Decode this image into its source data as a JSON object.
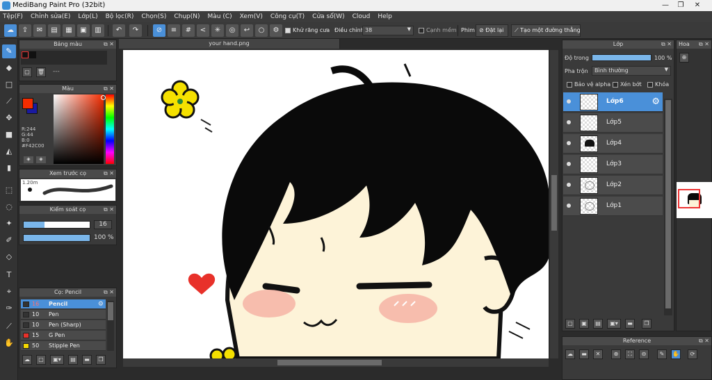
{
  "window": {
    "title": "MediBang Paint Pro (32bit)"
  },
  "menu": [
    "Tệp(F)",
    "Chỉnh sửa(E)",
    "Lớp(L)",
    "Bộ lọc(R)",
    "Chọn(S)",
    "Chụp(N)",
    "Màu (C)",
    "Xem(V)",
    "Công cụ(T)",
    "Cửa sổ(W)",
    "Cloud",
    "Help"
  ],
  "toolbar": {
    "antialias_label": "Khử răng cưa",
    "adjust_label": "Điều chỉnh",
    "adjust_value": "38",
    "snap_label": "Cạnh mềm",
    "pen_label": "Phim",
    "reset_label": "Đặt lại",
    "straight_line_label": "Tạo một đường thẳng"
  },
  "palette_panel": {
    "title": "Bảng màu",
    "placeholder": "---"
  },
  "color_panel": {
    "title": "Màu",
    "r": "R:244",
    "g": "G:44",
    "b": "B:0",
    "hex": "#F42C00",
    "main_color": "#F42C00"
  },
  "brush_preview": {
    "title": "Xem trước cọ",
    "size": "1.20m"
  },
  "brush_control": {
    "title": "Kiểm soát cọ",
    "size_value": "16",
    "opacity_value": "100 %",
    "size_fraction": 0.32,
    "opacity_fraction": 1.0
  },
  "brush_panel": {
    "title": "Cọ: Pencil",
    "items": [
      {
        "size": "16",
        "name": "Pencil",
        "color": "#333333",
        "selected": true
      },
      {
        "size": "10",
        "name": "Pen",
        "color": "#333333",
        "selected": false
      },
      {
        "size": "10",
        "name": "Pen (Sharp)",
        "color": "#333333",
        "selected": false
      },
      {
        "size": "15",
        "name": "G Pen",
        "color": "#e8312a",
        "selected": false
      },
      {
        "size": "50",
        "name": "Stipple Pen",
        "color": "#f5d800",
        "selected": false
      }
    ]
  },
  "canvas": {
    "tab_label": "your hand.png"
  },
  "layer_panel": {
    "title": "Lớp",
    "opacity_label": "Độ trong",
    "opacity_value": "100 %",
    "blend_label": "Pha trộn",
    "blend_value": "Bình thường",
    "protect_alpha": "Bảo vệ alpha",
    "clipping": "Xén bớt",
    "lock": "Khóa",
    "layers": [
      "Lớp6",
      "Lớp5",
      "Lớp4",
      "Lớp3",
      "Lớp2",
      "Lớp1"
    ]
  },
  "navigator_panel": {
    "title": "Hoa"
  },
  "reference_panel": {
    "title": "Reference"
  },
  "colors": {
    "accent": "#4a90d9",
    "hair": "#0a0a0a",
    "skin": "#fdf3d8",
    "blush": "#f6b3a6",
    "heart": "#e8312a",
    "flower": "#f5e000"
  }
}
